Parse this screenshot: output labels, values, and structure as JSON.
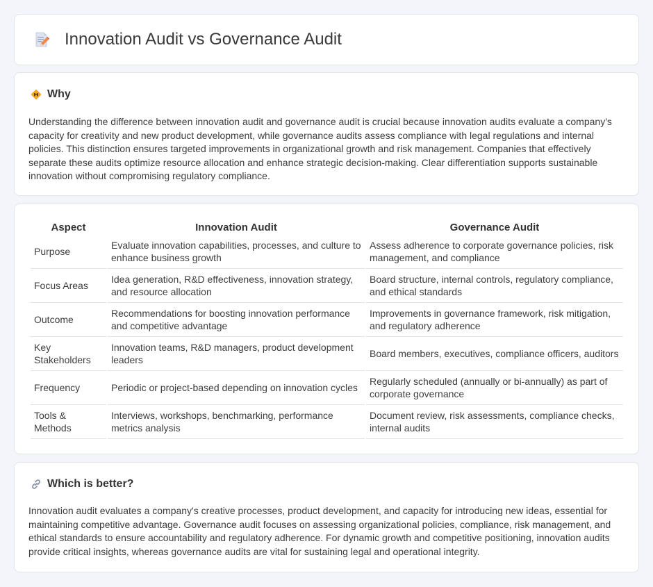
{
  "header": {
    "title": "Innovation Audit vs Governance Audit",
    "icon": "document-pen-icon"
  },
  "why": {
    "title": "Why",
    "icon": "diamond-sign-icon",
    "text": "Understanding the difference between innovation audit and governance audit is crucial because innovation audits evaluate a company's capacity for creativity and new product development, while governance audits assess compliance with legal regulations and internal policies. This distinction ensures targeted improvements in organizational growth and risk management. Companies that effectively separate these audits optimize resource allocation and enhance strategic decision-making. Clear differentiation supports sustainable innovation without compromising regulatory compliance."
  },
  "comparison": {
    "headers": [
      "Aspect",
      "Innovation Audit",
      "Governance Audit"
    ],
    "rows": [
      {
        "aspect": "Purpose",
        "innovation": "Evaluate innovation capabilities, processes, and culture to enhance business growth",
        "governance": "Assess adherence to corporate governance policies, risk management, and compliance"
      },
      {
        "aspect": "Focus Areas",
        "innovation": "Idea generation, R&D effectiveness, innovation strategy, and resource allocation",
        "governance": "Board structure, internal controls, regulatory compliance, and ethical standards"
      },
      {
        "aspect": "Outcome",
        "innovation": "Recommendations for boosting innovation performance and competitive advantage",
        "governance": "Improvements in governance framework, risk mitigation, and regulatory adherence"
      },
      {
        "aspect": "Key Stakeholders",
        "innovation": "Innovation teams, R&D managers, product development leaders",
        "governance": "Board members, executives, compliance officers, auditors"
      },
      {
        "aspect": "Frequency",
        "innovation": "Periodic or project-based depending on innovation cycles",
        "governance": "Regularly scheduled (annually or bi-annually) as part of corporate governance"
      },
      {
        "aspect": "Tools & Methods",
        "innovation": "Interviews, workshops, benchmarking, performance metrics analysis",
        "governance": "Document review, risk assessments, compliance checks, internal audits"
      }
    ]
  },
  "better": {
    "title": "Which is better?",
    "icon": "link-icon",
    "text": "Innovation audit evaluates a company's creative processes, product development, and capacity for introducing new ideas, essential for maintaining competitive advantage. Governance audit focuses on assessing organizational policies, compliance, risk management, and ethical standards to ensure accountability and regulatory adherence. For dynamic growth and competitive positioning, innovation audits provide critical insights, whereas governance audits are vital for sustaining legal and operational integrity."
  }
}
